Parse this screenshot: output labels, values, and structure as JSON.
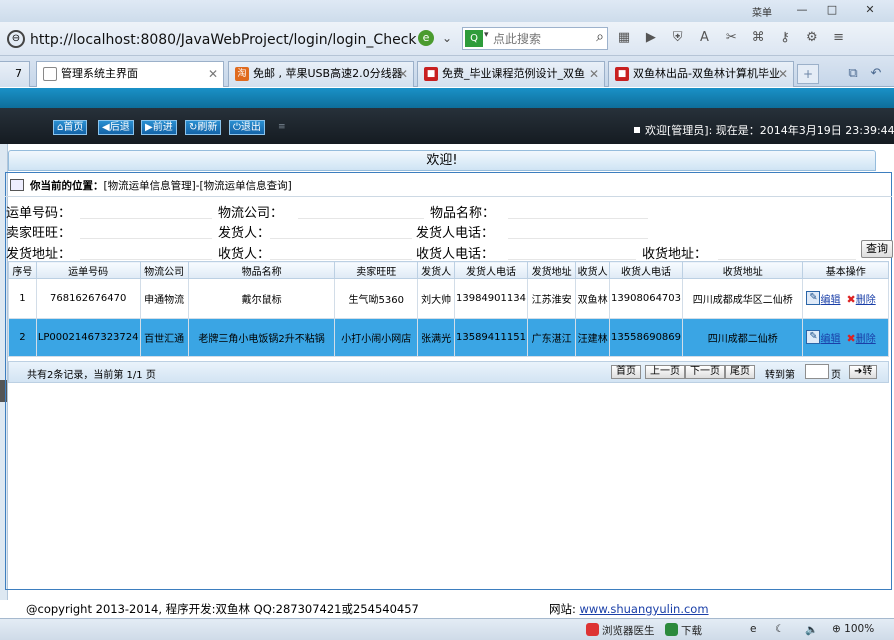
{
  "browser": {
    "skin_label": "菜单",
    "url": "http://localhost:8080/JavaWebProject/login/login_Check",
    "search_placeholder": "点此搜索",
    "tabs": [
      {
        "label": "7",
        "icon": "page-icon",
        "color": "#999"
      },
      {
        "label": "管理系统主界面",
        "icon": "page-icon",
        "color": "#fff"
      },
      {
        "label": "免邮 , 苹果USB高速2.0分线器",
        "icon": "shop-icon",
        "color": "#e06a1e"
      },
      {
        "label": "免费_毕业课程范例设计_双鱼",
        "icon": "shop-icon",
        "color": "#c82020"
      },
      {
        "label": "双鱼林出品-双鱼林计算机毕业",
        "icon": "shop-icon",
        "color": "#c82020"
      }
    ],
    "status": {
      "doctor": "浏览器医生",
      "download": "下载",
      "zoom": "100%"
    }
  },
  "nav": {
    "home": "首页",
    "back": "后退",
    "forward": "前进",
    "refresh": "刷新",
    "logout": "退出",
    "welcome": "欢迎[管理员]:  现在是：2014年3月19日 23:39:44"
  },
  "welcome_bar": "欢迎!",
  "location": {
    "prefix": "你当前的位置：",
    "path": "[物流运单信息管理]-[物流运单信息查询]"
  },
  "query": {
    "waybill_no": "运单号码：",
    "company": "物流公司：",
    "item_name": "物品名称：",
    "seller": "卖家旺旺：",
    "sender": "发货人：",
    "sender_phone": "发货人电话：",
    "send_addr": "发货地址：",
    "receiver": "收货人：",
    "receiver_phone": "收货人电话：",
    "recv_addr": "收货地址：",
    "submit": "查询"
  },
  "table": {
    "headers": [
      "序号",
      "运单号码",
      "物流公司",
      "物品名称",
      "卖家旺旺",
      "发货人",
      "发货人电话",
      "发货地址",
      "收货人",
      "收货人电话",
      "收货地址",
      "基本操作"
    ],
    "rows": [
      [
        "1",
        "768162676470",
        "申通物流",
        "戴尔鼠标",
        "生气呦5360",
        "刘大帅",
        "13984901134",
        "江苏淮安",
        "双鱼林",
        "13908064703",
        "四川成都成华区二仙桥"
      ],
      [
        "2",
        "LP00021467323724",
        "百世汇通",
        "老牌三角小电饭锅2升不粘锅",
        "小打小闹小网店",
        "张满光",
        "13589411151",
        "广东湛江",
        "汪建林",
        "13558690869",
        "四川成都二仙桥"
      ]
    ],
    "edit_label": "编辑",
    "delete_label": "删除"
  },
  "pager": {
    "info": "共有2条记录，当前第 1/1 页",
    "first": "首页",
    "prev": "上一页",
    "next": "下一页",
    "last": "尾页",
    "goto": "转到第",
    "page_unit": "页",
    "go": "转"
  },
  "footer": {
    "copyright": "@copyright 2013-2014, 程序开发:双鱼林  QQ:287307421或254540457",
    "site_label": "网站:",
    "site_url": "www.shuangyulin.com"
  }
}
